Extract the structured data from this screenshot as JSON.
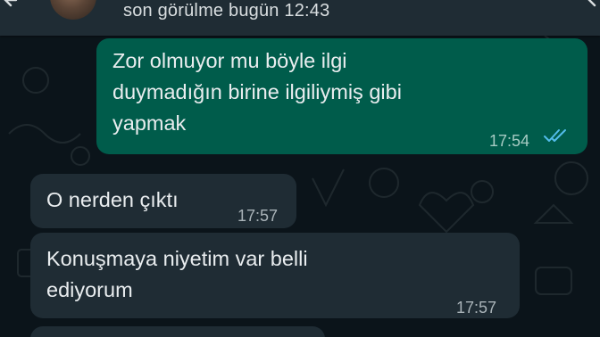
{
  "header": {
    "status": "son görülme bugün 12:43"
  },
  "messages": [
    {
      "direction": "outgoing",
      "lines": [
        "Zor olmuyor mu böyle ilgi",
        "duymadığın birine ilgiliymiş gibi",
        "yapmak"
      ],
      "time": "17:54",
      "read": true
    },
    {
      "direction": "incoming",
      "lines": [
        "O nerden çıktı"
      ],
      "time": "17:57"
    },
    {
      "direction": "incoming",
      "lines": [
        "Konuşmaya niyetim var belli",
        "ediyorum"
      ],
      "time": "17:57"
    }
  ],
  "colors": {
    "background": "#0b141a",
    "header": "#1f2c34",
    "outgoing_bubble": "#005c4b",
    "incoming_bubble": "#1f2c34",
    "read_ticks": "#53bdeb"
  },
  "icons": {
    "back": "arrow-left-icon",
    "read_receipt": "double-check-icon"
  }
}
